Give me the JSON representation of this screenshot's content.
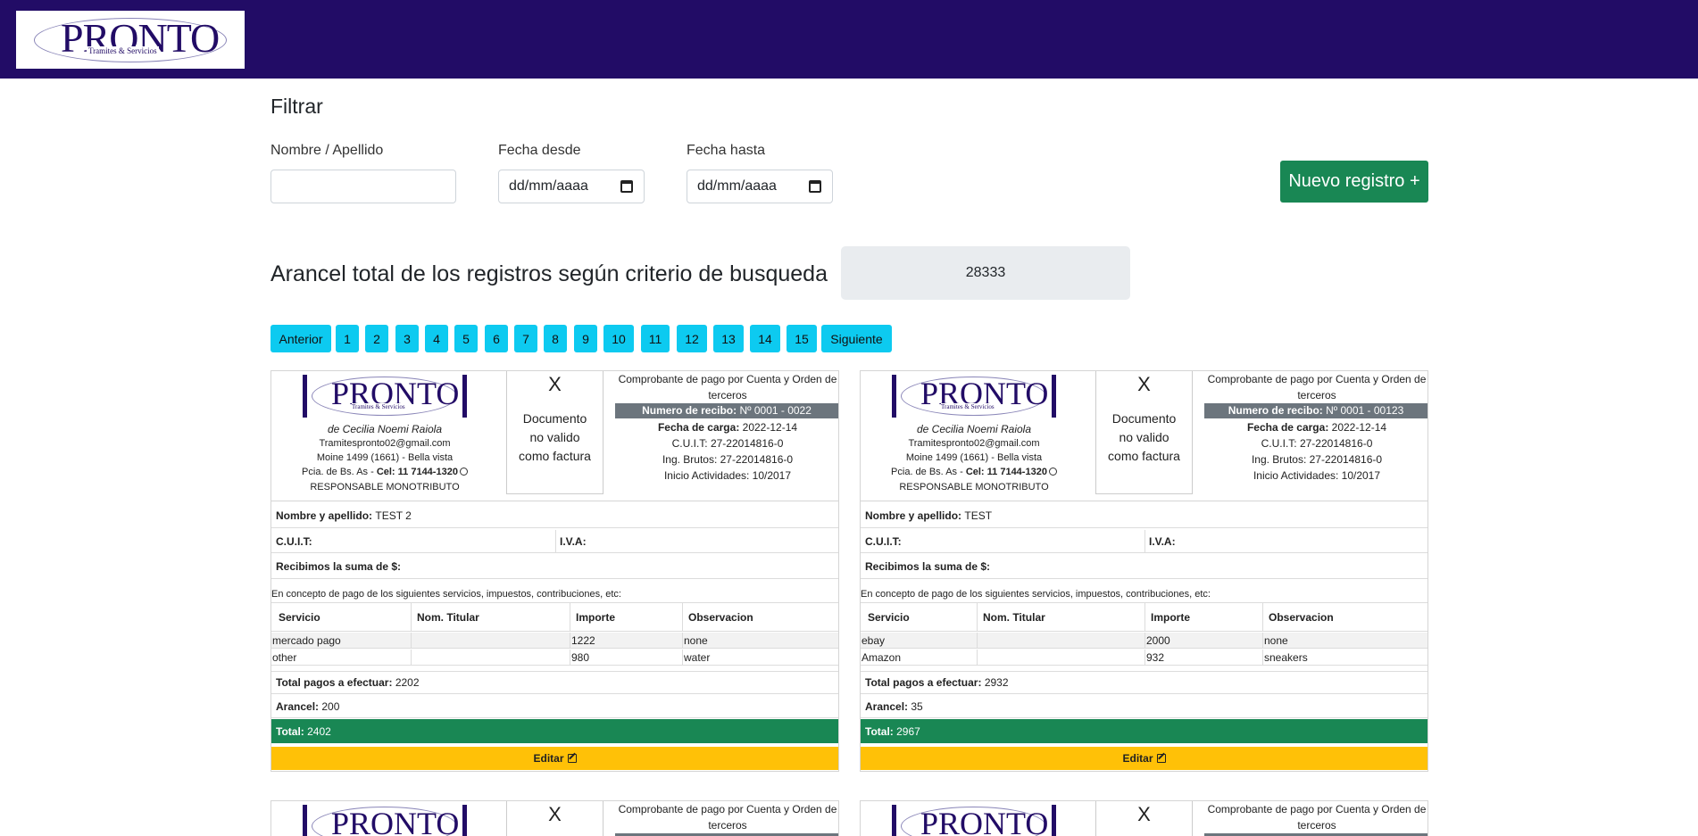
{
  "header": {
    "logo_text": "PRONTO",
    "logo_sub": "Tramites & Servicios"
  },
  "filter": {
    "title": "Filtrar",
    "name_label": "Nombre / Apellido",
    "name_value": "",
    "from_label": "Fecha desde",
    "from_placeholder": "dd/mm/aaaa",
    "to_label": "Fecha hasta",
    "to_placeholder": "dd/mm/aaaa",
    "new_button": "Nuevo registro +"
  },
  "arancel": {
    "label": "Arancel total de los registros según criterio de busqueda",
    "value": "28333"
  },
  "pagination": {
    "prev": "Anterior",
    "pages": [
      "1",
      "2",
      "3",
      "4",
      "5",
      "6",
      "7",
      "8",
      "9",
      "10",
      "11",
      "12",
      "13",
      "14",
      "15"
    ],
    "next": "Siguiente"
  },
  "receipt_common": {
    "company_owner": "de Cecilia Noemi Raiola",
    "email": "Tramitespronto02@gmail.com",
    "address": "Moine 1499 (1661) - Bella vista",
    "province": "Pcia. de Bs. As -",
    "cel_label": "Cel: 11 7144-1320",
    "tax_status": "RESPONSABLE MONOTRIBUTO",
    "x_mark": "X",
    "invalid_line1": "Documento",
    "invalid_line2": "no valido",
    "invalid_line3": "como factura",
    "comprobante_line1": "Comprobante de pago por Cuenta y Orden de",
    "comprobante_line2": "terceros",
    "recibo_label": "Numero de recibo:",
    "carga_label": "Fecha de carga:",
    "cuit_company": "C.U.I.T: 27-22014816-0",
    "ing_brutos": "Ing. Brutos: 27-22014816-0",
    "inicio": "Inicio Actividades: 10/2017",
    "name_label": "Nombre y apellido:",
    "cuit_label": "C.U.I.T:",
    "iva_label": "I.V.A:",
    "suma_label": "Recibimos la suma de $:",
    "concepto": "En concepto de pago de los siguientes servicios, impuestos, contribuciones, etc:",
    "col_servicio": "Servicio",
    "col_titular": "Nom. Titular",
    "col_importe": "Importe",
    "col_observacion": "Observacion",
    "total_pagos_label": "Total pagos a efectuar:",
    "arancel_label": "Arancel:",
    "total_label": "Total:",
    "edit_label": "Editar"
  },
  "receipts": [
    {
      "recibo": "Nº 0001 - 0022",
      "fecha_carga": "2022-12-14",
      "name": "TEST 2",
      "rows": [
        {
          "servicio": "mercado pago",
          "titular": "",
          "importe": "1222",
          "observacion": "none"
        },
        {
          "servicio": "other",
          "titular": "",
          "importe": "980",
          "observacion": "water"
        }
      ],
      "total_pagos": "2202",
      "arancel": "200",
      "total": "2402"
    },
    {
      "recibo": "Nº 0001 - 00123",
      "fecha_carga": "2022-12-14",
      "name": "TEST",
      "rows": [
        {
          "servicio": "ebay",
          "titular": "",
          "importe": "2000",
          "observacion": "none"
        },
        {
          "servicio": "Amazon",
          "titular": "",
          "importe": "932",
          "observacion": "sneakers"
        }
      ],
      "total_pagos": "2932",
      "arancel": "35",
      "total": "2967"
    }
  ],
  "colors": {
    "navbar": "#220c66",
    "success": "#198754",
    "info": "#0dcaf0",
    "warning": "#ffc107"
  }
}
